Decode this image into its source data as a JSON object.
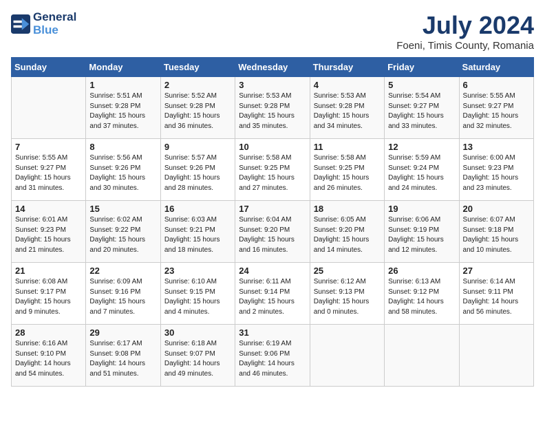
{
  "header": {
    "logo_line1": "General",
    "logo_line2": "Blue",
    "month_year": "July 2024",
    "location": "Foeni, Timis County, Romania"
  },
  "weekdays": [
    "Sunday",
    "Monday",
    "Tuesday",
    "Wednesday",
    "Thursday",
    "Friday",
    "Saturday"
  ],
  "weeks": [
    [
      {
        "day": "",
        "info": ""
      },
      {
        "day": "1",
        "info": "Sunrise: 5:51 AM\nSunset: 9:28 PM\nDaylight: 15 hours\nand 37 minutes."
      },
      {
        "day": "2",
        "info": "Sunrise: 5:52 AM\nSunset: 9:28 PM\nDaylight: 15 hours\nand 36 minutes."
      },
      {
        "day": "3",
        "info": "Sunrise: 5:53 AM\nSunset: 9:28 PM\nDaylight: 15 hours\nand 35 minutes."
      },
      {
        "day": "4",
        "info": "Sunrise: 5:53 AM\nSunset: 9:28 PM\nDaylight: 15 hours\nand 34 minutes."
      },
      {
        "day": "5",
        "info": "Sunrise: 5:54 AM\nSunset: 9:27 PM\nDaylight: 15 hours\nand 33 minutes."
      },
      {
        "day": "6",
        "info": "Sunrise: 5:55 AM\nSunset: 9:27 PM\nDaylight: 15 hours\nand 32 minutes."
      }
    ],
    [
      {
        "day": "7",
        "info": "Sunrise: 5:55 AM\nSunset: 9:27 PM\nDaylight: 15 hours\nand 31 minutes."
      },
      {
        "day": "8",
        "info": "Sunrise: 5:56 AM\nSunset: 9:26 PM\nDaylight: 15 hours\nand 30 minutes."
      },
      {
        "day": "9",
        "info": "Sunrise: 5:57 AM\nSunset: 9:26 PM\nDaylight: 15 hours\nand 28 minutes."
      },
      {
        "day": "10",
        "info": "Sunrise: 5:58 AM\nSunset: 9:25 PM\nDaylight: 15 hours\nand 27 minutes."
      },
      {
        "day": "11",
        "info": "Sunrise: 5:58 AM\nSunset: 9:25 PM\nDaylight: 15 hours\nand 26 minutes."
      },
      {
        "day": "12",
        "info": "Sunrise: 5:59 AM\nSunset: 9:24 PM\nDaylight: 15 hours\nand 24 minutes."
      },
      {
        "day": "13",
        "info": "Sunrise: 6:00 AM\nSunset: 9:23 PM\nDaylight: 15 hours\nand 23 minutes."
      }
    ],
    [
      {
        "day": "14",
        "info": "Sunrise: 6:01 AM\nSunset: 9:23 PM\nDaylight: 15 hours\nand 21 minutes."
      },
      {
        "day": "15",
        "info": "Sunrise: 6:02 AM\nSunset: 9:22 PM\nDaylight: 15 hours\nand 20 minutes."
      },
      {
        "day": "16",
        "info": "Sunrise: 6:03 AM\nSunset: 9:21 PM\nDaylight: 15 hours\nand 18 minutes."
      },
      {
        "day": "17",
        "info": "Sunrise: 6:04 AM\nSunset: 9:20 PM\nDaylight: 15 hours\nand 16 minutes."
      },
      {
        "day": "18",
        "info": "Sunrise: 6:05 AM\nSunset: 9:20 PM\nDaylight: 15 hours\nand 14 minutes."
      },
      {
        "day": "19",
        "info": "Sunrise: 6:06 AM\nSunset: 9:19 PM\nDaylight: 15 hours\nand 12 minutes."
      },
      {
        "day": "20",
        "info": "Sunrise: 6:07 AM\nSunset: 9:18 PM\nDaylight: 15 hours\nand 10 minutes."
      }
    ],
    [
      {
        "day": "21",
        "info": "Sunrise: 6:08 AM\nSunset: 9:17 PM\nDaylight: 15 hours\nand 9 minutes."
      },
      {
        "day": "22",
        "info": "Sunrise: 6:09 AM\nSunset: 9:16 PM\nDaylight: 15 hours\nand 7 minutes."
      },
      {
        "day": "23",
        "info": "Sunrise: 6:10 AM\nSunset: 9:15 PM\nDaylight: 15 hours\nand 4 minutes."
      },
      {
        "day": "24",
        "info": "Sunrise: 6:11 AM\nSunset: 9:14 PM\nDaylight: 15 hours\nand 2 minutes."
      },
      {
        "day": "25",
        "info": "Sunrise: 6:12 AM\nSunset: 9:13 PM\nDaylight: 15 hours\nand 0 minutes."
      },
      {
        "day": "26",
        "info": "Sunrise: 6:13 AM\nSunset: 9:12 PM\nDaylight: 14 hours\nand 58 minutes."
      },
      {
        "day": "27",
        "info": "Sunrise: 6:14 AM\nSunset: 9:11 PM\nDaylight: 14 hours\nand 56 minutes."
      }
    ],
    [
      {
        "day": "28",
        "info": "Sunrise: 6:16 AM\nSunset: 9:10 PM\nDaylight: 14 hours\nand 54 minutes."
      },
      {
        "day": "29",
        "info": "Sunrise: 6:17 AM\nSunset: 9:08 PM\nDaylight: 14 hours\nand 51 minutes."
      },
      {
        "day": "30",
        "info": "Sunrise: 6:18 AM\nSunset: 9:07 PM\nDaylight: 14 hours\nand 49 minutes."
      },
      {
        "day": "31",
        "info": "Sunrise: 6:19 AM\nSunset: 9:06 PM\nDaylight: 14 hours\nand 46 minutes."
      },
      {
        "day": "",
        "info": ""
      },
      {
        "day": "",
        "info": ""
      },
      {
        "day": "",
        "info": ""
      }
    ]
  ]
}
